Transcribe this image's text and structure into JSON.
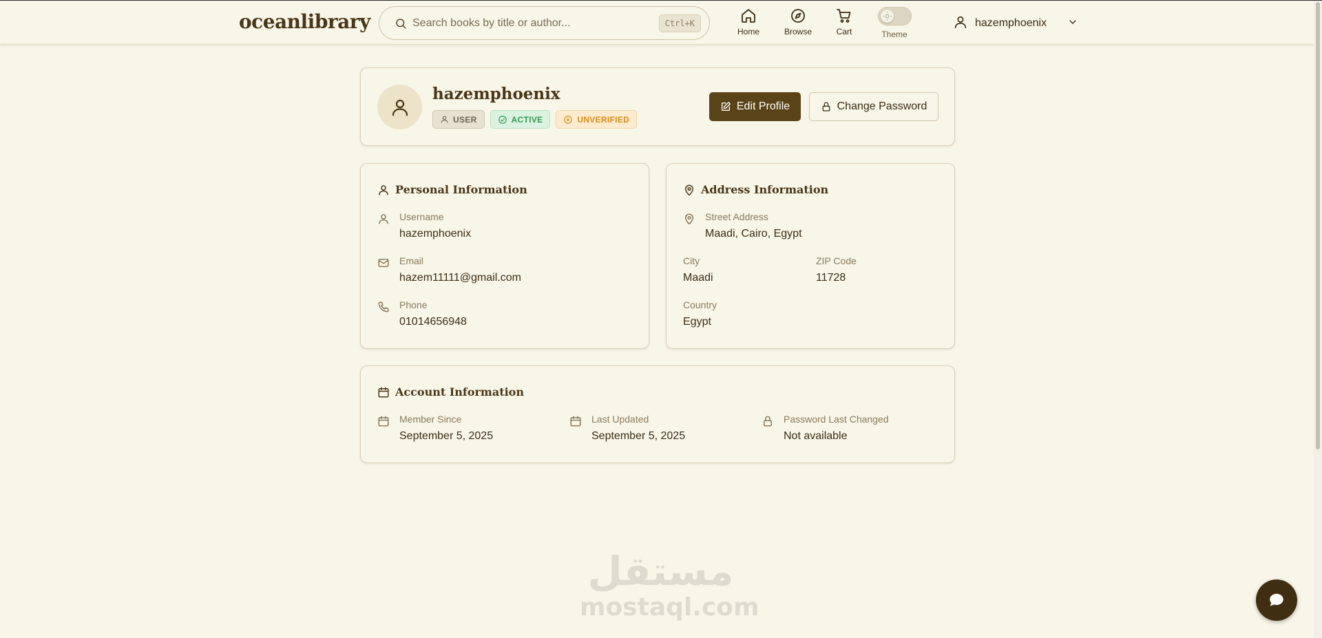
{
  "header": {
    "logo": "oceanlibrary",
    "search_placeholder": "Search books by title or author...",
    "search_shortcut": "Ctrl+K",
    "nav": [
      {
        "label": "Home",
        "icon": "home-icon"
      },
      {
        "label": "Browse",
        "icon": "compass-icon"
      },
      {
        "label": "Cart",
        "icon": "cart-icon"
      }
    ],
    "theme_label": "Theme",
    "username": "hazemphoenix"
  },
  "profile": {
    "name": "hazemphoenix",
    "badges": {
      "role": "USER",
      "status": "ACTIVE",
      "verification": "UNVERIFIED"
    },
    "edit_label": "Edit Profile",
    "change_password_label": "Change Password"
  },
  "personal": {
    "title": "Personal Information",
    "username_label": "Username",
    "username": "hazemphoenix",
    "email_label": "Email",
    "email": "hazem11111@gmail.com",
    "phone_label": "Phone",
    "phone": "01014656948"
  },
  "address": {
    "title": "Address Information",
    "street_label": "Street Address",
    "street": "Maadi, Cairo, Egypt",
    "city_label": "City",
    "city": "Maadi",
    "zip_label": "ZIP Code",
    "zip": "11728",
    "country_label": "Country",
    "country": "Egypt"
  },
  "account": {
    "title": "Account Information",
    "member_since_label": "Member Since",
    "member_since": "September 5, 2025",
    "last_updated_label": "Last Updated",
    "last_updated": "September 5, 2025",
    "password_changed_label": "Password Last Changed",
    "password_changed": "Not available"
  },
  "watermark": {
    "arabic": "مستقل",
    "latin": "mostaql.com"
  },
  "colors": {
    "background": "#f8f5e9",
    "primary": "#5b4319",
    "text": "#3a2c14",
    "active_badge": "#2f9a50",
    "unverified_badge": "#d98d1a"
  }
}
